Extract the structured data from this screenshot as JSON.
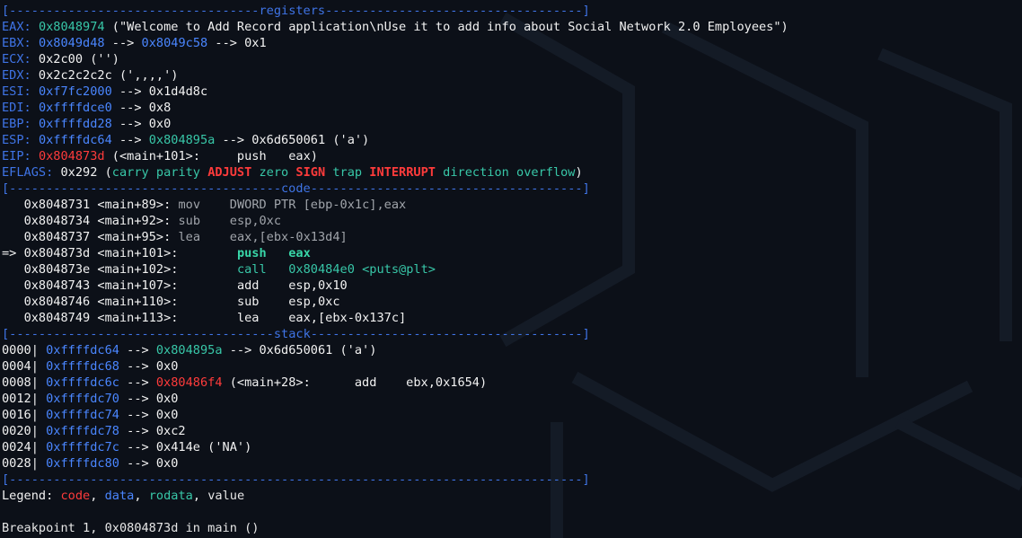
{
  "colors": {
    "background": "#0c1018",
    "separator": "#3f74e6",
    "code": "#ff3b3b",
    "data": "#4a86ff",
    "rodata": "#38c7a8",
    "value": "#e6e6e6",
    "current_instruction": "#38d6a8"
  },
  "sections": {
    "registers": {
      "left": "[----------------------------------",
      "label": "registers",
      "right": "-----------------------------------]"
    },
    "code": {
      "left": "[-------------------------------------",
      "label": "code",
      "right": "-------------------------------------]"
    },
    "stack": {
      "left": "[------------------------------------",
      "label": "stack",
      "right": "-------------------------------------]"
    },
    "end": "[------------------------------------------------------------------------------]"
  },
  "registers": [
    {
      "name": "EAX:",
      "parts": [
        {
          "t": " "
        },
        {
          "t": "0x8048974",
          "c": "ro"
        },
        {
          "t": " (\"Welcome to Add Record application\\nUse it to add info about Social Network 2.0 Employees\")"
        }
      ]
    },
    {
      "name": "EBX:",
      "parts": [
        {
          "t": " "
        },
        {
          "t": "0x8049d48",
          "c": "data"
        },
        {
          "t": " --> "
        },
        {
          "t": "0x8049c58",
          "c": "data"
        },
        {
          "t": " --> 0x1"
        }
      ]
    },
    {
      "name": "ECX:",
      "parts": [
        {
          "t": " 0x2c00 ('')"
        }
      ]
    },
    {
      "name": "EDX:",
      "parts": [
        {
          "t": " 0x2c2c2c2c (',,,,')"
        }
      ]
    },
    {
      "name": "ESI:",
      "parts": [
        {
          "t": " "
        },
        {
          "t": "0xf7fc2000",
          "c": "data"
        },
        {
          "t": " --> 0x1d4d8c"
        }
      ]
    },
    {
      "name": "EDI:",
      "parts": [
        {
          "t": " "
        },
        {
          "t": "0xffffdce0",
          "c": "data"
        },
        {
          "t": " --> 0x8"
        }
      ]
    },
    {
      "name": "EBP:",
      "parts": [
        {
          "t": " "
        },
        {
          "t": "0xffffdd28",
          "c": "data"
        },
        {
          "t": " --> 0x0"
        }
      ]
    },
    {
      "name": "ESP:",
      "parts": [
        {
          "t": " "
        },
        {
          "t": "0xffffdc64",
          "c": "data"
        },
        {
          "t": " --> "
        },
        {
          "t": "0x804895a",
          "c": "ro"
        },
        {
          "t": " --> 0x6d650061 ('a')"
        }
      ]
    },
    {
      "name": "EIP:",
      "parts": [
        {
          "t": " "
        },
        {
          "t": "0x804873d",
          "c": "code"
        },
        {
          "t": " (<main+101>:     push   eax)"
        }
      ]
    }
  ],
  "eflags": {
    "name": "EFLAGS:",
    "value": " 0x292 (",
    "flags": [
      {
        "t": "carry",
        "on": false
      },
      {
        "t": "parity",
        "on": false
      },
      {
        "t": "ADJUST",
        "on": true
      },
      {
        "t": "zero",
        "on": false
      },
      {
        "t": "SIGN",
        "on": true
      },
      {
        "t": "trap",
        "on": false
      },
      {
        "t": "INTERRUPT",
        "on": true
      },
      {
        "t": "direction",
        "on": false
      },
      {
        "t": "overflow",
        "on": false
      }
    ],
    "close": ")"
  },
  "code_lines": [
    {
      "prefix": "   ",
      "addr": "0x8048731",
      "sym": "<main+89>:",
      "gap": " ",
      "mnem": "mov",
      "pad": "    ",
      "ops": "DWORD PTR [ebp-0x1c],eax",
      "style": "prev"
    },
    {
      "prefix": "   ",
      "addr": "0x8048734",
      "sym": "<main+92>:",
      "gap": " ",
      "mnem": "sub",
      "pad": "    ",
      "ops": "esp,0xc",
      "style": "prev"
    },
    {
      "prefix": "   ",
      "addr": "0x8048737",
      "sym": "<main+95>:",
      "gap": " ",
      "mnem": "lea",
      "pad": "    ",
      "ops": "eax,[ebx-0x13d4]",
      "style": "prev"
    },
    {
      "prefix": "=> ",
      "addr": "0x804873d",
      "sym": "<main+101>:",
      "gap": "        ",
      "mnem": "push",
      "pad": "   ",
      "ops": "eax",
      "style": "cur"
    },
    {
      "prefix": "   ",
      "addr": "0x804873e",
      "sym": "<main+102>:",
      "gap": "        ",
      "mnem": "call",
      "pad": "   ",
      "ops": "0x80484e0 <puts@plt>",
      "style": "next"
    },
    {
      "prefix": "   ",
      "addr": "0x8048743",
      "sym": "<main+107>:",
      "gap": "        ",
      "mnem": "add",
      "pad": "    ",
      "ops": "esp,0x10",
      "style": "plain"
    },
    {
      "prefix": "   ",
      "addr": "0x8048746",
      "sym": "<main+110>:",
      "gap": "        ",
      "mnem": "sub",
      "pad": "    ",
      "ops": "esp,0xc",
      "style": "plain"
    },
    {
      "prefix": "   ",
      "addr": "0x8048749",
      "sym": "<main+113>:",
      "gap": "        ",
      "mnem": "lea",
      "pad": "    ",
      "ops": "eax,[ebx-0x137c]",
      "style": "plain"
    }
  ],
  "stack": [
    {
      "off": "0000|",
      "parts": [
        {
          "t": " "
        },
        {
          "t": "0xffffdc64",
          "c": "data"
        },
        {
          "t": " --> "
        },
        {
          "t": "0x804895a",
          "c": "ro"
        },
        {
          "t": " --> 0x6d650061 ('a')"
        }
      ]
    },
    {
      "off": "0004|",
      "parts": [
        {
          "t": " "
        },
        {
          "t": "0xffffdc68",
          "c": "data"
        },
        {
          "t": " --> 0x0"
        }
      ]
    },
    {
      "off": "0008|",
      "parts": [
        {
          "t": " "
        },
        {
          "t": "0xffffdc6c",
          "c": "data"
        },
        {
          "t": " --> "
        },
        {
          "t": "0x80486f4",
          "c": "code"
        },
        {
          "t": " (<main+28>:      add    ebx,0x1654)"
        }
      ]
    },
    {
      "off": "0012|",
      "parts": [
        {
          "t": " "
        },
        {
          "t": "0xffffdc70",
          "c": "data"
        },
        {
          "t": " --> 0x0"
        }
      ]
    },
    {
      "off": "0016|",
      "parts": [
        {
          "t": " "
        },
        {
          "t": "0xffffdc74",
          "c": "data"
        },
        {
          "t": " --> 0x0"
        }
      ]
    },
    {
      "off": "0020|",
      "parts": [
        {
          "t": " "
        },
        {
          "t": "0xffffdc78",
          "c": "data"
        },
        {
          "t": " --> 0xc2"
        }
      ]
    },
    {
      "off": "0024|",
      "parts": [
        {
          "t": " "
        },
        {
          "t": "0xffffdc7c",
          "c": "data"
        },
        {
          "t": " --> 0x414e ('NA')"
        }
      ]
    },
    {
      "off": "0028|",
      "parts": [
        {
          "t": " "
        },
        {
          "t": "0xffffdc80",
          "c": "data"
        },
        {
          "t": " --> 0x0"
        }
      ]
    }
  ],
  "legend": {
    "label": "Legend: ",
    "items": [
      {
        "t": "code",
        "c": "code"
      },
      {
        "t": ", "
      },
      {
        "t": "data",
        "c": "data"
      },
      {
        "t": ", "
      },
      {
        "t": "rodata",
        "c": "ro"
      },
      {
        "t": ", "
      },
      {
        "t": "value",
        "c": "val"
      }
    ]
  },
  "status": "Breakpoint 1, 0x0804873d in main ()"
}
